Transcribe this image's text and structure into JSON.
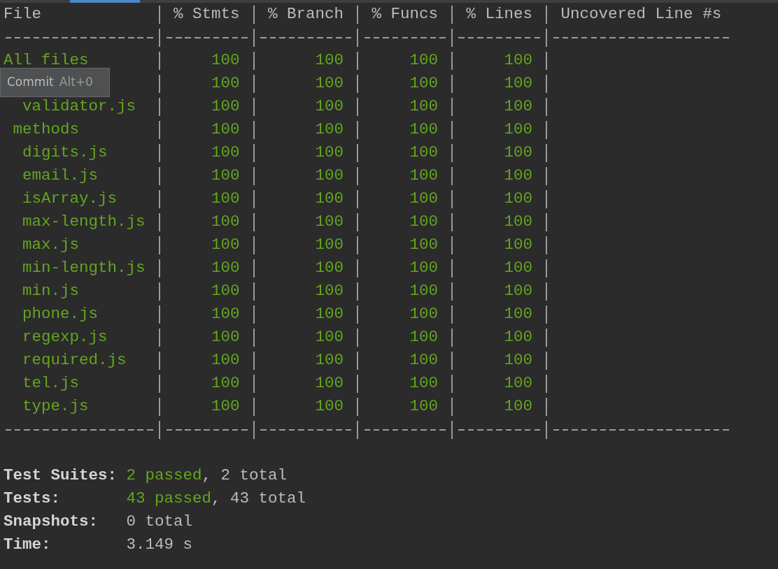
{
  "tooltip": {
    "label": "Commit",
    "shortcut": "Alt+0"
  },
  "table": {
    "columns": [
      "File",
      "% Stmts",
      "% Branch",
      "% Funcs",
      "% Lines",
      "Uncovered Line #s"
    ],
    "rows": [
      {
        "name": "All files",
        "values": [
          "100",
          "100",
          "100",
          "100"
        ],
        "children": [
          {
            "values": [
              "100",
              "100",
              "100",
              "100"
            ],
            "children": [
              {
                "name": "validator.js",
                "values": [
                  "100",
                  "100",
                  "100",
                  "100"
                ]
              }
            ]
          },
          {
            "name": "methods",
            "values": [
              "100",
              "100",
              "100",
              "100"
            ],
            "children": [
              {
                "name": "digits.js",
                "values": [
                  "100",
                  "100",
                  "100",
                  "100"
                ]
              },
              {
                "name": "email.js",
                "values": [
                  "100",
                  "100",
                  "100",
                  "100"
                ]
              },
              {
                "name": "isArray.js",
                "values": [
                  "100",
                  "100",
                  "100",
                  "100"
                ]
              },
              {
                "name": "max-length.js",
                "values": [
                  "100",
                  "100",
                  "100",
                  "100"
                ]
              },
              {
                "name": "max.js",
                "values": [
                  "100",
                  "100",
                  "100",
                  "100"
                ]
              },
              {
                "name": "min-length.js",
                "values": [
                  "100",
                  "100",
                  "100",
                  "100"
                ]
              },
              {
                "name": "min.js",
                "values": [
                  "100",
                  "100",
                  "100",
                  "100"
                ]
              },
              {
                "name": "phone.js",
                "values": [
                  "100",
                  "100",
                  "100",
                  "100"
                ]
              },
              {
                "name": "regexp.js",
                "values": [
                  "100",
                  "100",
                  "100",
                  "100"
                ]
              },
              {
                "name": "required.js",
                "values": [
                  "100",
                  "100",
                  "100",
                  "100"
                ]
              },
              {
                "name": "tel.js",
                "values": [
                  "100",
                  "100",
                  "100",
                  "100"
                ]
              },
              {
                "name": "type.js",
                "values": [
                  "100",
                  "100",
                  "100",
                  "100"
                ]
              }
            ]
          }
        ]
      }
    ]
  },
  "summary": [
    {
      "label": "Test Suites:",
      "value": [
        {
          "text": "2 passed",
          "kind": "pass"
        },
        {
          "text": ", 2 total",
          "kind": "plain"
        }
      ]
    },
    {
      "label": "Tests:",
      "value": [
        {
          "text": "43 passed",
          "kind": "pass"
        },
        {
          "text": ", 43 total",
          "kind": "plain"
        }
      ]
    },
    {
      "label": "Snapshots:",
      "value": [
        {
          "text": "0 total",
          "kind": "plain"
        }
      ]
    },
    {
      "label": "Time:",
      "value": [
        {
          "text": "3.149 s",
          "kind": "plain"
        }
      ]
    }
  ]
}
